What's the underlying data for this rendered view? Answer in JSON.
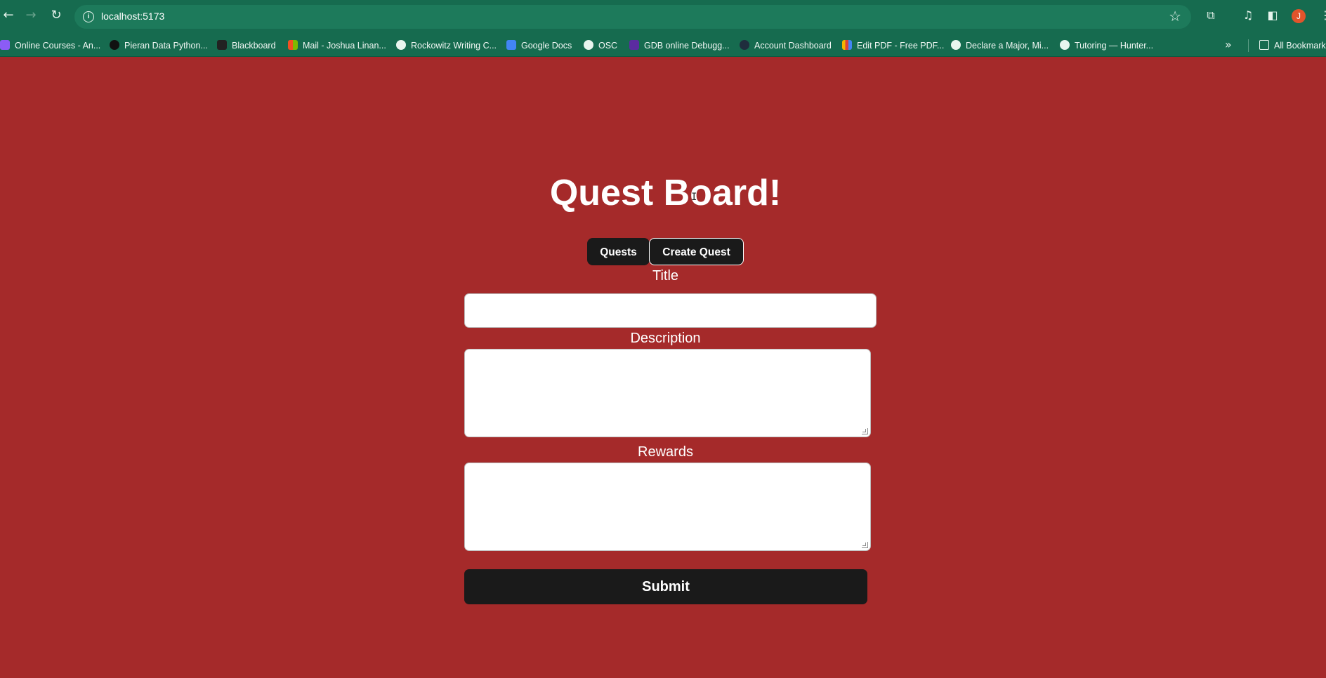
{
  "browser": {
    "url": "localhost:5173",
    "profile_initial": "J",
    "bookmarks": [
      {
        "label": "Online Courses - An...",
        "icon": "course-icon",
        "color": "#8b5cf6"
      },
      {
        "label": "Pieran Data Python...",
        "icon": "github-icon",
        "color": "#111111"
      },
      {
        "label": "Blackboard",
        "icon": "blackboard-icon",
        "color": "#222222"
      },
      {
        "label": "Mail - Joshua Linan...",
        "icon": "microsoft-icon",
        "color": "#f25022"
      },
      {
        "label": "Rockowitz Writing C...",
        "icon": "globe-icon",
        "color": "#e8f5ee"
      },
      {
        "label": "Google Docs",
        "icon": "docs-icon",
        "color": "#4285f4"
      },
      {
        "label": "OSC",
        "icon": "globe-icon",
        "color": "#e8f5ee"
      },
      {
        "label": "GDB online Debugg...",
        "icon": "gdb-icon",
        "color": "#5b2ca0"
      },
      {
        "label": "Account Dashboard",
        "icon": "fsa-icon",
        "color": "#1f2d3d"
      },
      {
        "label": "Edit PDF - Free PDF...",
        "icon": "pdf-icon",
        "color": "#f4b400"
      },
      {
        "label": "Declare a Major, Mi...",
        "icon": "globe-icon",
        "color": "#e8f5ee"
      },
      {
        "label": "Tutoring — Hunter...",
        "icon": "globe-icon",
        "color": "#e8f5ee"
      }
    ],
    "all_bookmarks": "All Bookmarks"
  },
  "page": {
    "title": "Quest Board!",
    "tabs": [
      {
        "label": "Quests",
        "active": false
      },
      {
        "label": "Create Quest",
        "active": true
      }
    ],
    "form": {
      "title_label": "Title",
      "title_value": "",
      "description_label": "Description",
      "description_value": "",
      "rewards_label": "Rewards",
      "rewards_value": "",
      "submit_label": "Submit"
    }
  },
  "colors": {
    "page_background": "#a52a2a",
    "chrome": "#166b4f",
    "button": "#1a1a1a"
  }
}
